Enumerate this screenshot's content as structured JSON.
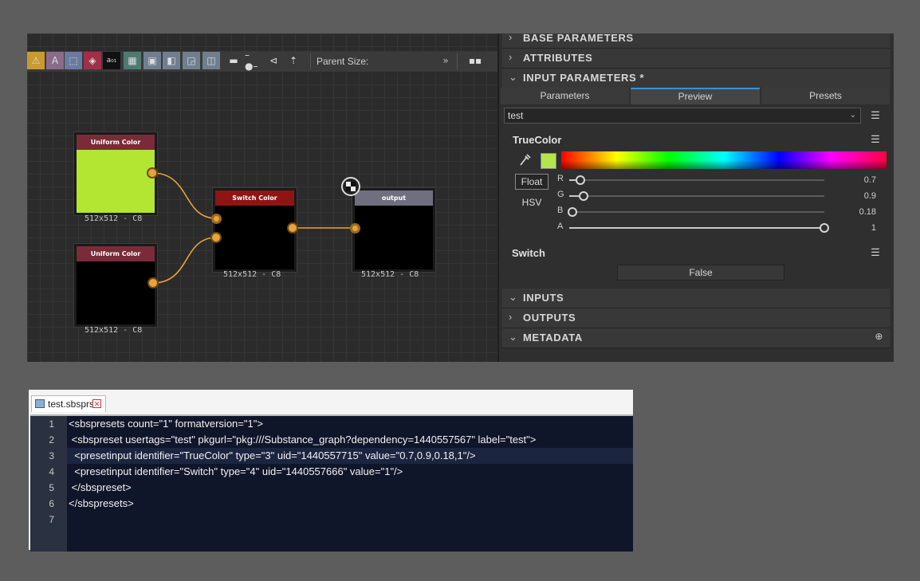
{
  "graph": {
    "toolbar": {
      "parent_size_label": "Parent Size:",
      "expand_glyph": "»"
    },
    "nodes": [
      {
        "id": "uniform1",
        "title": "Uniform Color",
        "caption": "512x512 - C8",
        "title_color": "#7a2b3a",
        "fill": "#b3e632"
      },
      {
        "id": "uniform2",
        "title": "Uniform Color",
        "caption": "512x512 - C8",
        "title_color": "#7a2b3a",
        "fill": "#000000"
      },
      {
        "id": "switch",
        "title": "Switch Color",
        "caption": "512x512 - C8",
        "title_color": "#8f1414",
        "fill": "#000000"
      },
      {
        "id": "output",
        "title": "output",
        "caption": "512x512 - C8",
        "title_color": "#6f6f80",
        "fill": "#000000"
      }
    ]
  },
  "panel": {
    "sections": [
      "BASE PARAMETERS",
      "ATTRIBUTES",
      "INPUT PARAMETERS *",
      "INPUTS",
      "OUTPUTS",
      "METADATA"
    ],
    "tabs": [
      "Parameters",
      "Preview",
      "Presets"
    ],
    "active_tab": "Preview",
    "preset_value": "test",
    "truecolor": {
      "label": "TrueColor",
      "swatch": "#b3e64d",
      "modes": [
        "Float",
        "HSV"
      ],
      "channels": [
        {
          "name": "R",
          "value": "0.7",
          "level": 0.7
        },
        {
          "name": "G",
          "value": "0.9",
          "level": 0.9
        },
        {
          "name": "B",
          "value": "0.18",
          "level": 0.18
        },
        {
          "name": "A",
          "value": "1",
          "level": 1.0
        }
      ]
    },
    "switch": {
      "label": "Switch",
      "value": "False"
    }
  },
  "editor": {
    "filename": "test.sbsprs",
    "lines": [
      "<sbspresets count=\"1\" formatversion=\"1\">",
      " <sbspreset usertags=\"test\" pkgurl=\"pkg:///Substance_graph?dependency=1440557567\" label=\"test\">",
      "  <presetinput identifier=\"TrueColor\" type=\"3\" uid=\"1440557715\" value=\"0.7,0.9,0.18,1\"/>",
      "  <presetinput identifier=\"Switch\" type=\"4\" uid=\"1440557666\" value=\"1\"/>",
      " </sbspreset>",
      "</sbspresets>",
      ""
    ],
    "line_numbers": [
      "1",
      "2",
      "3",
      "4",
      "5",
      "6",
      "7"
    ]
  }
}
